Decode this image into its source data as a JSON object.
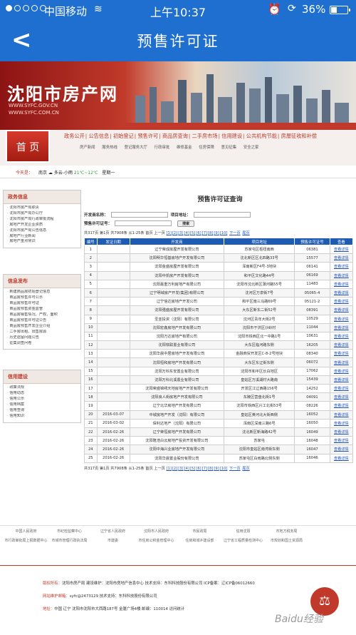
{
  "status_bar": {
    "carrier": "中国移动",
    "time": "上午10:37",
    "battery": "36%",
    "battery_level": 0.36,
    "wifi_icon": "wifi-icon",
    "alarm_icon": "alarm-icon",
    "orientation_lock_icon": "orientation-lock-icon"
  },
  "nav": {
    "back_icon": "chevron-left-icon",
    "title": "预售许可证"
  },
  "banner": {
    "site_name": "沈阳市房产网",
    "url1": "WWW.SYFC.GOV.CN",
    "url2": "WWW.SYFC.COM.CN"
  },
  "menu": {
    "home": "首 页",
    "main": [
      "政务公开",
      "公告信息",
      "初始登记",
      "预售许可",
      "商品房查询",
      "二手房市场",
      "信用建设",
      "公共机构节能",
      "房屋征收和补偿"
    ],
    "sub": [
      "房产新闻",
      "服务热线",
      "登记服务大厅",
      "行政审批",
      "维修基金",
      "住房保障",
      "意见征集",
      "安全之家"
    ]
  },
  "weather": {
    "label": "今天是：",
    "city": "南京",
    "desc": "多云-小雨",
    "temp": "21℃~12℃",
    "weekday": "星期一"
  },
  "sidebar": {
    "gov_title": "政务信息",
    "gov_items": [
      "沈阳市房产局职责",
      "沈阳市房产局办公厅",
      "沈阳市房产局行政审批流程",
      "房地产开发企业资质",
      "沈阳市房产局公告信息",
      "房地产行业新闻",
      "房地产重点常识"
    ],
    "info_title": "信息发布",
    "info_items": [
      "新建商品房初始登记信息",
      "商品房预售许可公示",
      "商品房预售许可证",
      "商品房预售资金监管",
      "商品房销售情况、产权、面积",
      "商品房预售许可证公告",
      "商品房预售开发企业介绍",
      "二手房出租、出售房源",
      "历史遗留问题公告",
      "征集调查问卷"
    ],
    "credit_title": "信用建设",
    "credit_items": [
      "政策法规",
      "信用动态",
      "信用公示",
      "信用档案",
      "信用查询",
      "信用知识"
    ]
  },
  "main": {
    "title": "预售许可证查询",
    "form": {
      "developer_label": "开发商名称：",
      "project_label": "项目地址：",
      "permit_label": "预售许可证号：",
      "search_button": "搜索"
    },
    "pager_prefix": "共317页 第1页 共7908条 从1-25条 首页 上一页",
    "pager_pages": [
      "[1]",
      "[2]",
      "[3]",
      "[4]",
      "[5]",
      "[6]",
      "[7]",
      "[8]",
      "[9]",
      "[10]"
    ],
    "pager_next": "下一页",
    "pager_last": "尾页"
  },
  "table": {
    "headers": [
      "编号",
      "发证日期",
      "开发商",
      "项目地址",
      "预售许可证号",
      "查看"
    ],
    "rows": [
      [
        "1",
        "",
        "辽宁荣成房屋开发有限公司",
        "苏家屯区枢纽南西",
        "06381",
        "查看详情"
      ],
      [
        "2",
        "",
        "沈阳明华恒基房地产开发有限公司",
        "沈北新区区北四路33号",
        "15577",
        "查看详情"
      ],
      [
        "3",
        "",
        "沈阳金盛房屋开发有限公司",
        "浑南新区F4号-3地块",
        "06141",
        "查看详情"
      ],
      [
        "4",
        "",
        "沈阳中凯房产开发有限公司",
        "和平区文化路44号",
        "06169",
        "查看详情"
      ],
      [
        "5",
        "",
        "沈阳嘉重万利房地产有限公司",
        "沈阳市沈北新区蒲河路55号",
        "11483",
        "查看详情"
      ],
      [
        "6",
        "",
        "辽宁明域房产开发(集团)有限公司",
        "沈河区万泉街7号",
        "05065-4",
        "查看详情"
      ],
      [
        "7",
        "",
        "辽宁信达房地产开发公司",
        "和平区南三马路69号",
        "05121-2",
        "查看详情"
      ],
      [
        "8",
        "",
        "沈阳强盛房屋开发有限公司",
        "大东区新东二街52号",
        "08391",
        "查看详情"
      ],
      [
        "9",
        "",
        "圣亚投资（沈阳）有限公司",
        "沈河区青年大街2号",
        "10529",
        "查看详情"
      ],
      [
        "10",
        "",
        "沈阳宏鑫房地产开发有限公司",
        "沈阳市于洪区沙岭村",
        "11044",
        "查看详情"
      ],
      [
        "11",
        "",
        "沈阳万达房地产有限公司",
        "沈阳市铁西区北一中路1号",
        "10631",
        "查看详情"
      ],
      [
        "12",
        "",
        "沈阳铁联置业有限公司",
        "大东区临河路东侧",
        "16205",
        "查看详情"
      ],
      [
        "13",
        "",
        "沈阳华晨中居房地产开发有限公司",
        "金融商贸开发区C-8-2号地块",
        "08340",
        "查看详情"
      ],
      [
        "14",
        "",
        "沈阳恒和房地产开发有限公司",
        "大东区东辽街东侧",
        "06072",
        "查看详情"
      ],
      [
        "15",
        "",
        "沈阳万科东安置业有限公司",
        "沈阳市和平区长白地区",
        "17062",
        "查看详情"
      ],
      [
        "16",
        "",
        "沈阳万科北溪置业有限公司",
        "皇姑区万溪湖村大路南",
        "15439",
        "查看详情"
      ],
      [
        "17",
        "",
        "沈阳荣盛锦绣天地房地产开发有限公司",
        "开发区江辽西路156号",
        "14252",
        "查看详情"
      ],
      [
        "18",
        "",
        "沈阳良人街房地产开发有限公司",
        "东陵区营盘北街1号",
        "04091",
        "查看详情"
      ],
      [
        "19",
        "",
        "辽宁北华房地产开发有限公司",
        "沈阳市铁西区兴工北街53号",
        "08226",
        "查看详情"
      ],
      [
        "20",
        "2016-03-07",
        "中城房地产开发（沈阳）有限公司",
        "皇姑区黄河北大街西侧",
        "16052",
        "查看详情"
      ],
      [
        "21",
        "2016-03-02",
        "保利达地产（沈阳）有限公司",
        "浑南区深南三路6号",
        "16050",
        "查看详情"
      ],
      [
        "22",
        "2016-02-26",
        "辽宁荣恒房地产开发有限公司",
        "沈北新区新海路42号",
        "16049",
        "查看详情"
      ],
      [
        "23",
        "2016-02-26",
        "沈阳隆浩白云房地产投资开发有限公司",
        "苏家屯",
        "16048",
        "查看详情"
      ],
      [
        "24",
        "2016-02-26",
        "沈阳中海兴业房地产开发有限公司",
        "沈阳市皇姑区南湾街东侧",
        "16047",
        "查看详情"
      ],
      [
        "25",
        "2016-02-26",
        "沈阳华晨置业股份有限公司",
        "苏家屯区白雨路北侧东侧",
        "16046",
        "查看详情"
      ]
    ]
  },
  "footer_links": [
    "中国人民政府",
    "市纪检监察中心",
    "辽宁省人民政府",
    "沈阳市人民政府",
    "市民政局",
    "信用沈阳",
    "市地方税务局",
    "",
    "市行政审批局上报数据中心",
    "市城市管理行政执法局",
    "市建委",
    "市住房公积金管理中心",
    "住房和城乡建设部",
    "辽宁省工程质量检测中心",
    "市规划和国土资源局",
    ""
  ],
  "footer": {
    "line1_label": "版权所有：",
    "line1": "沈阳市房产局  建设维护：沈阳市房地产信息中心  技术支持：东科科技股份有限公司  ICP备案：辽ICP备06012660",
    "line2_label": "网站维护邮箱：",
    "line2": "syfc@2473129  技术支持：东科科技股份有限公司",
    "line3_label": "地址：",
    "line3": "中国 辽宁 沈阳市沈阳市大西路187号 金厦广场4楼  邮编：110014  访问统计",
    "badge": "⚖",
    "watermark": "Baidu经验"
  },
  "colors": {
    "brand_blue": "#1e6fd0",
    "brand_red": "#c0392b",
    "table_header": "#1e5cb3",
    "link": "#2255bb"
  }
}
